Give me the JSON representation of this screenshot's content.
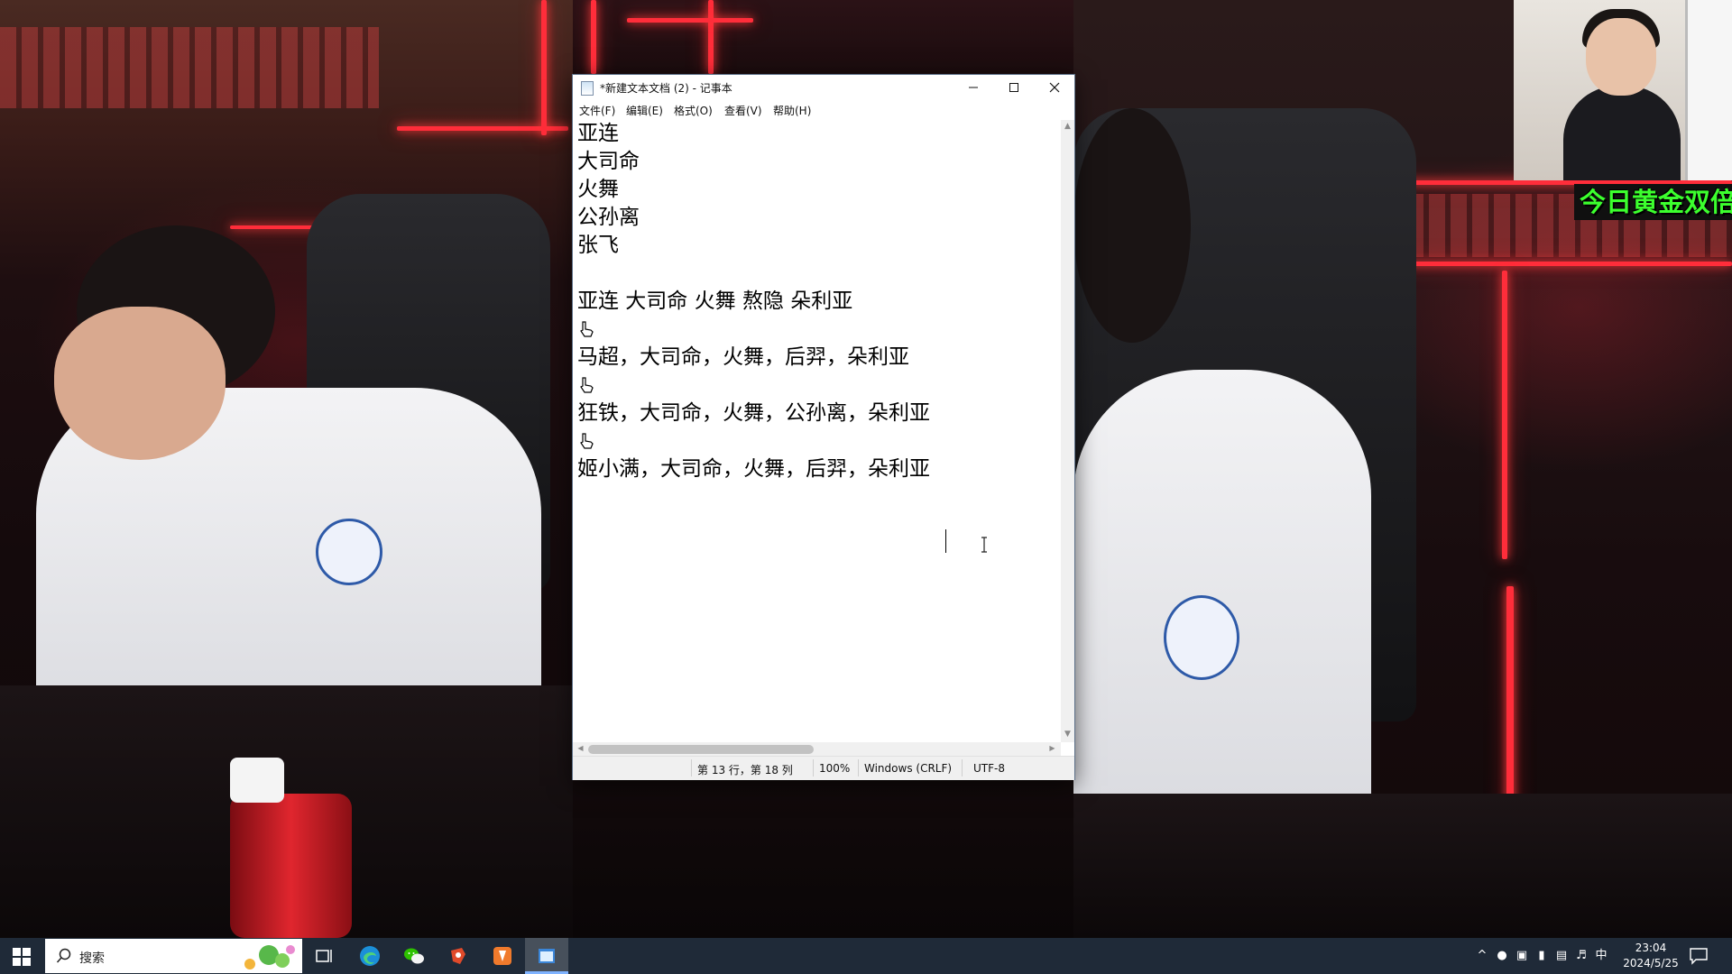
{
  "overlay": {
    "banner_text": "今日黄金双倍"
  },
  "notepad": {
    "title": "*新建文本文档 (2) - 记事本",
    "menu": [
      "文件(F)",
      "编辑(E)",
      "格式(O)",
      "查看(V)",
      "帮助(H)"
    ],
    "lines": [
      "亚连",
      "大司命",
      "火舞",
      "公孙离",
      "张飞",
      "",
      "亚连 大司命 火舞 熬隐 朵利亚",
      "",
      "马超，大司命，火舞，后羿，朵利亚",
      "",
      "狂铁，大司命，火舞，公孙离，朵利亚",
      "",
      "姬小满，大司命，火舞，后羿，朵利亚"
    ],
    "status": {
      "position": "第 13 行，第 18 列",
      "zoom": "100%",
      "line_ending": "Windows (CRLF)",
      "encoding": "UTF-8"
    },
    "controls": {
      "minimize_icon": "minimize-icon",
      "maximize_icon": "maximize-icon",
      "close_icon": "close-icon"
    }
  },
  "taskbar": {
    "search_placeholder": "搜索",
    "apps": [
      "task-view-icon",
      "edge-icon",
      "wechat-icon",
      "app-icon-red",
      "app-icon-orange",
      "notepad-icon"
    ],
    "tray": {
      "ime": "中",
      "time": "23:04",
      "date": "2024/5/25"
    }
  },
  "colors": {
    "taskbar": "#1f2a38",
    "banner_text": "#3cff2e",
    "neon": "#ff2d3a"
  }
}
